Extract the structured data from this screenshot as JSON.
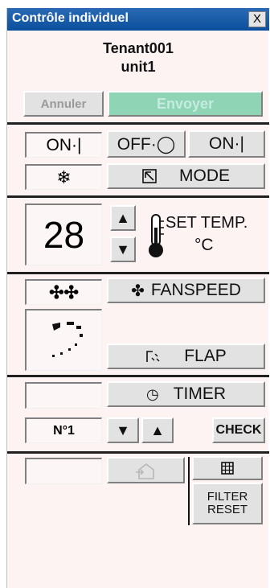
{
  "window": {
    "title": "Contrôle individuel",
    "close_label": "X"
  },
  "unit": {
    "tenant": "Tenant001",
    "name": "unit1"
  },
  "actions": {
    "cancel": "Annuler",
    "send": "Envoyer"
  },
  "power": {
    "status": "ON·|",
    "off_label": "OFF·◯",
    "on_label": "ON·|"
  },
  "mode": {
    "label": "MODE"
  },
  "temperature": {
    "value": "28",
    "set_label": "SET TEMP.",
    "unit": "°C"
  },
  "fanspeed": {
    "label": "FANSPEED"
  },
  "flap": {
    "label": "FLAP"
  },
  "timer": {
    "label": "TIMER",
    "number": "N°1",
    "check": "CHECK"
  },
  "filter": {
    "reset_line1": "FILTER",
    "reset_line2": "RESET"
  },
  "colors": {
    "titlebar": "#0b4f9c",
    "send_button": "#8fd4b4",
    "panel": "#fdf3f3"
  }
}
